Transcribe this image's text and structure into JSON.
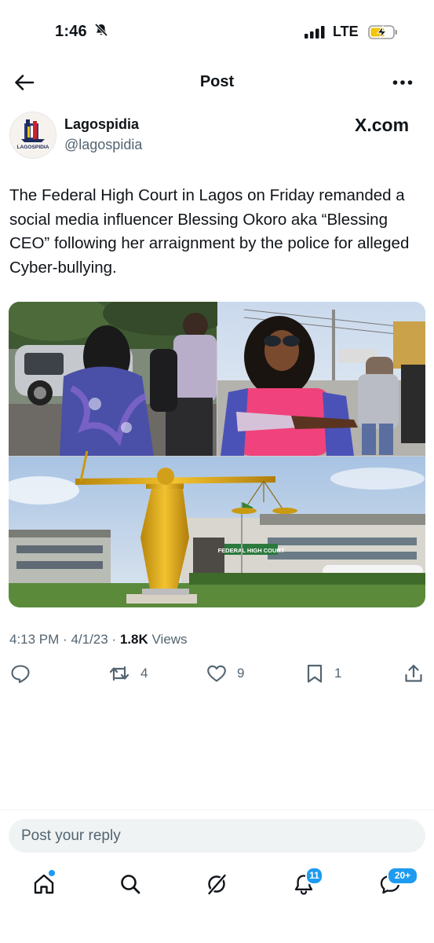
{
  "status_bar": {
    "time": "1:46",
    "network": "LTE"
  },
  "header": {
    "title": "Post",
    "back_icon": "arrow-left-icon",
    "more_icon": "more-icon"
  },
  "author": {
    "name": "Lagospidia",
    "handle": "@lagospidia",
    "source": "X.com",
    "avatar_text": "LAGOSPIDIA"
  },
  "post": {
    "text": "The Federal High Court in Lagos on Friday remanded a social media influencer Blessing Okoro aka “Blessing CEO” following her arraignment by the police for alleged Cyber-bullying.",
    "media_caption": "FEDERAL HIGH COURT"
  },
  "meta": {
    "time": "4:13 PM",
    "date": "4/1/23",
    "views_count": "1.8K",
    "views_label": "Views",
    "separator": "·"
  },
  "actions": {
    "reply_count": "",
    "repost_count": "4",
    "like_count": "9",
    "bookmark_count": "1"
  },
  "reply": {
    "placeholder": "Post your reply"
  },
  "bottom_nav": {
    "notifications_badge": "11",
    "messages_badge": "20+"
  },
  "colors": {
    "accent": "#1d9bf0",
    "text": "#0f1419",
    "secondary": "#536471"
  }
}
